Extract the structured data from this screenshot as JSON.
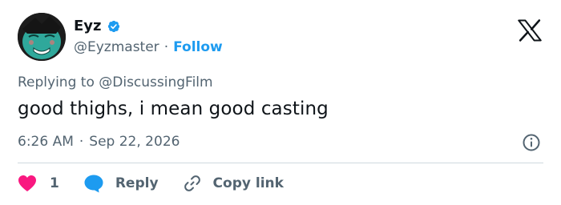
{
  "user": {
    "display_name": "Eyz",
    "handle": "@Eyzmaster",
    "separator": "·",
    "follow_label": "Follow"
  },
  "reply_context": {
    "prefix": "Replying to",
    "mention": "@DiscussingFilm"
  },
  "tweet": {
    "text": "good thighs, i mean good casting",
    "time": "6:26 AM",
    "separator": "·",
    "date": "Sep 22, 2026"
  },
  "actions": {
    "like_count": "1",
    "reply_label": "Reply",
    "copy_label": "Copy link"
  },
  "colors": {
    "accent": "#1d9bf0",
    "like": "#f91880",
    "text_primary": "#0f1419",
    "text_secondary": "#536471",
    "divider": "#cfd9de"
  },
  "icons": [
    "verified-badge-icon",
    "x-logo-icon",
    "info-icon",
    "heart-icon",
    "reply-bubble-icon",
    "link-icon"
  ]
}
